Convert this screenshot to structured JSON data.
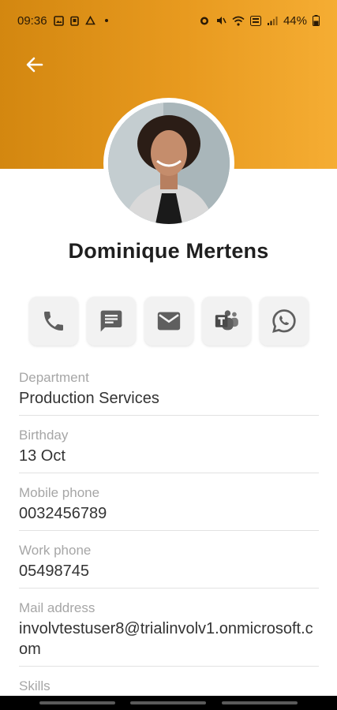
{
  "status_bar": {
    "time": "09:36",
    "battery": "44%"
  },
  "profile": {
    "name": "Dominique Mertens"
  },
  "actions": [
    {
      "icon": "phone-icon"
    },
    {
      "icon": "message-icon"
    },
    {
      "icon": "mail-icon"
    },
    {
      "icon": "teams-icon"
    },
    {
      "icon": "whatsapp-icon"
    }
  ],
  "fields": [
    {
      "label": "Department",
      "value": "Production Services"
    },
    {
      "label": "Birthday",
      "value": "13 Oct"
    },
    {
      "label": "Mobile phone",
      "value": "0032456789"
    },
    {
      "label": "Work phone",
      "value": "05498745"
    },
    {
      "label": "Mail address",
      "value": "involvtestuser8@trialinvolv1.onmicrosoft.com"
    },
    {
      "label": "Skills",
      "value": ""
    }
  ],
  "colors": {
    "header_start": "#d38710",
    "header_end": "#f5ad33"
  }
}
